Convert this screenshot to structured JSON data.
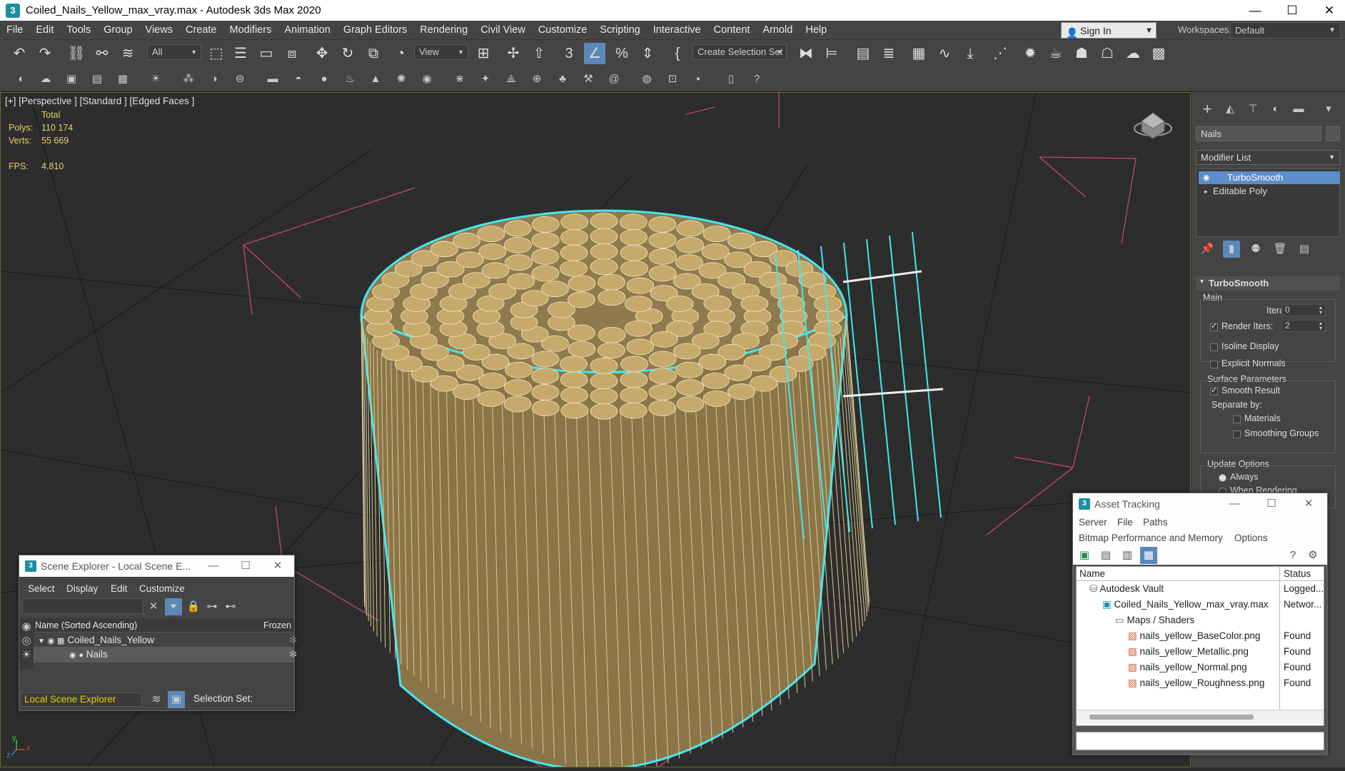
{
  "window": {
    "title": "Coiled_Nails_Yellow_max_vray.max - Autodesk 3ds Max 2020",
    "app_icon": "3"
  },
  "menu": [
    "File",
    "Edit",
    "Tools",
    "Group",
    "Views",
    "Create",
    "Modifiers",
    "Animation",
    "Graph Editors",
    "Rendering",
    "Civil View",
    "Customize",
    "Scripting",
    "Interactive",
    "Content",
    "Arnold",
    "Help"
  ],
  "account": {
    "sign_in": "Sign In",
    "workspaces_label": "Workspaces:",
    "workspace": "Default"
  },
  "toolbar": {
    "filter": "All",
    "ref_coord": "View",
    "selection_set": "Create Selection Set",
    "snap_label": "3"
  },
  "viewport": {
    "label": "[+] [Perspective ] [Standard ] [Edged Faces ]",
    "stats": {
      "total_label": "Total",
      "polys_label": "Polys:",
      "polys": "110 174",
      "verts_label": "Verts:",
      "verts": "55 669",
      "fps_label": "FPS:",
      "fps": "4.810"
    },
    "axis_x": "x",
    "axis_y": "y",
    "axis_z": "z"
  },
  "command_panel": {
    "object_name": "Nails",
    "modifier_list": "Modifier List",
    "stack": [
      "TurboSmooth",
      "Editable Poly"
    ],
    "rollout_title": "TurboSmooth",
    "main_label": "Main",
    "iterations_label": "Iterations:",
    "iterations": "0",
    "render_iters_label": "Render Iters:",
    "render_iters": "2",
    "isoline_label": "Isoline Display",
    "explicit_normals_label": "Explicit Normals",
    "surface_params": "Surface Parameters",
    "smooth_result": "Smooth Result",
    "separate_by": "Separate by:",
    "materials": "Materials",
    "smoothing_groups": "Smoothing Groups",
    "update_options": "Update Options",
    "always": "Always",
    "when_rendering": "When Rendering"
  },
  "scene_explorer": {
    "title": "Scene Explorer - Local Scene E...",
    "menu": [
      "Select",
      "Display",
      "Edit",
      "Customize"
    ],
    "col_name": "Name (Sorted Ascending)",
    "col_frozen": "Frozen",
    "rows": [
      {
        "name": "Coiled_Nails_Yellow"
      },
      {
        "name": "Nails"
      }
    ],
    "footer_dropdown": "Local Scene Explorer",
    "selection_set_label": "Selection Set:"
  },
  "asset_tracking": {
    "title": "Asset Tracking",
    "menu1": [
      "Server",
      "File",
      "Paths"
    ],
    "menu2": [
      "Bitmap Performance and Memory",
      "Options"
    ],
    "col_name": "Name",
    "col_status": "Status",
    "rows": [
      {
        "name": "Autodesk Vault",
        "status": "Logged..."
      },
      {
        "name": "Coiled_Nails_Yellow_max_vray.max",
        "status": "Networ..."
      },
      {
        "name": "Maps / Shaders",
        "status": ""
      },
      {
        "name": "nails_yellow_BaseColor.png",
        "status": "Found"
      },
      {
        "name": "nails_yellow_Metallic.png",
        "status": "Found"
      },
      {
        "name": "nails_yellow_Normal.png",
        "status": "Found"
      },
      {
        "name": "nails_yellow_Roughness.png",
        "status": "Found"
      }
    ]
  },
  "colors": {
    "accent": "#5b88b8",
    "selection": "#5c8dc9",
    "viewport_bg": "#2d2d2d",
    "ui_bg": "#444444",
    "stats": "#e2d36a",
    "nail_gold": "#b89a5c",
    "selection_outline": "#44e6f0"
  }
}
